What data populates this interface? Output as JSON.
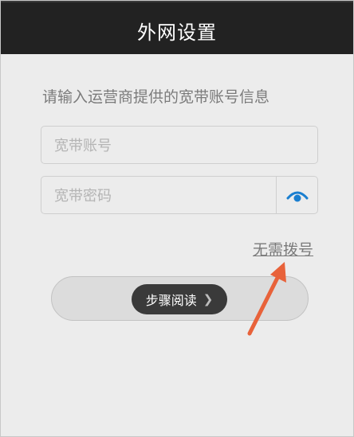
{
  "header": {
    "title": "外网设置"
  },
  "form": {
    "hint": "请输入运营商提供的宽带账号信息",
    "account_placeholder": "宽带账号",
    "password_placeholder": "宽带密码",
    "password_toggle_icon": "eye-icon",
    "no_dial_link": "无需拨号"
  },
  "overlay": {
    "tip_label": "步骤阅读",
    "tip_icon": "chevron-right-icon",
    "arrow_color": "#e8623a"
  },
  "colors": {
    "accent": "#1a7fd0",
    "header_bg": "#222222"
  }
}
